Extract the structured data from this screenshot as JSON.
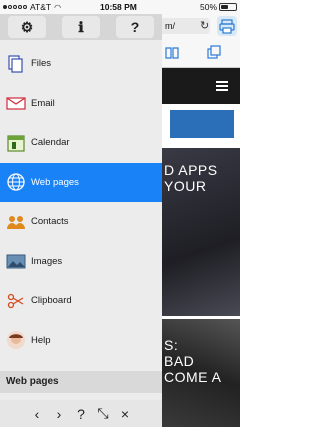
{
  "status": {
    "carrier": "AT&T",
    "time": "10:58 PM",
    "battery": "50%",
    "battery_level": 0.5
  },
  "browser": {
    "url_fragment": "m/",
    "hero_text_1": "D APPS\nYOUR",
    "hero_text_2": "S:\nBAD\nCOME A"
  },
  "menu": {
    "top_buttons": [
      {
        "icon": "gear-icon",
        "glyph": "⚙"
      },
      {
        "icon": "info-icon",
        "glyph": "ℹ"
      },
      {
        "icon": "help-icon",
        "glyph": "?"
      }
    ],
    "items": [
      {
        "label": "Files",
        "icon": "files-icon"
      },
      {
        "label": "Email",
        "icon": "email-icon"
      },
      {
        "label": "Calendar",
        "icon": "calendar-icon"
      },
      {
        "label": "Web pages",
        "icon": "globe-icon",
        "active": true
      },
      {
        "label": "Contacts",
        "icon": "contacts-icon"
      },
      {
        "label": "Images",
        "icon": "images-icon"
      },
      {
        "label": "Clipboard",
        "icon": "clipboard-icon"
      },
      {
        "label": "Help",
        "icon": "help-avatar-icon"
      }
    ],
    "section_title": "Web pages",
    "bottom_buttons": [
      {
        "icon": "back-icon",
        "glyph": "‹"
      },
      {
        "icon": "forward-icon",
        "glyph": "›"
      },
      {
        "icon": "help-icon",
        "glyph": "?"
      },
      {
        "icon": "collapse-icon",
        "glyph": "⤡"
      },
      {
        "icon": "close-icon",
        "glyph": "×"
      }
    ]
  },
  "colors": {
    "active": "#1a82f7",
    "menu_bg": "#ececec"
  }
}
